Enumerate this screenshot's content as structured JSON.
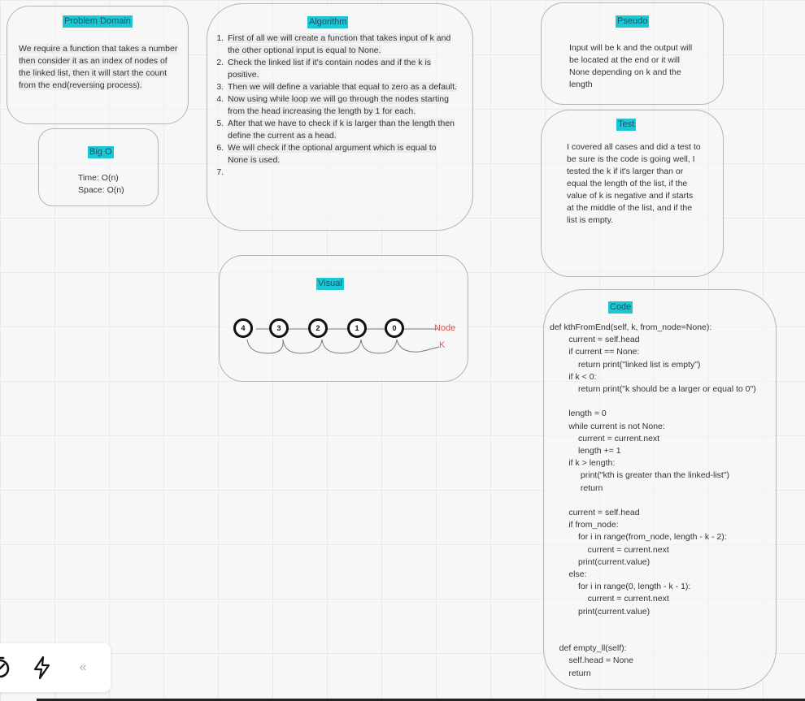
{
  "problem_domain": {
    "title": "Problem Domain",
    "text": "We require a function that takes a number then consider it as an index of nodes of the linked list, then it will start the count from the end(reversing process)."
  },
  "big_o": {
    "title": "Big O",
    "time": "Time: O(n)",
    "space": "Space: O(n)"
  },
  "algorithm": {
    "title": "Algorithm",
    "steps": [
      "First of all we will create a function that takes input of k and the other optional input is equal to None.",
      "Check the linked list if it's contain nodes and if the k is positive.",
      "Then we will define a variable that equal to zero as a default.",
      "Now using while loop we will go through the nodes starting from the head increasing the length by 1 for each.",
      "After that we have to check if k is larger than the length then define the current as a head.",
      "We will check if the optional argument which is equal to None is used.",
      ""
    ]
  },
  "pseudo": {
    "title": "Pseudo",
    "text": "Input will be k and the output will be located at the end or it will None depending on k and the length"
  },
  "test": {
    "title": "Test",
    "text": "I covered all cases and did a test to be sure is the code is going well, I tested the k if it's larger than or equal the length of the list, if the value of k is negative and if starts at the middle of the list, and if the list is empty."
  },
  "visual": {
    "title": "Visual",
    "nodes": [
      "4",
      "3",
      "2",
      "1",
      "0"
    ],
    "node_label": "Node",
    "k_label": "K",
    "label_color": "#e05050"
  },
  "code": {
    "title": "Code",
    "lines": [
      "def kthFromEnd(self, k, from_node=None):",
      "        current = self.head",
      "        if current == None:",
      "            return print(\"linked list is empty\")",
      "        if k < 0:",
      "            return print(\"k should be a larger or equal to 0\")",
      "",
      "        length = 0",
      "        while current is not None:",
      "            current = current.next",
      "            length += 1",
      "        if k > length:",
      "             print(\"kth is greater than the linked-list\")",
      "             return",
      "",
      "        current = self.head",
      "        if from_node:",
      "            for i in range(from_node, length - k - 2):",
      "                current = current.next",
      "            print(current.value)",
      "        else:",
      "            for i in range(0, length - k - 1):",
      "                current = current.next",
      "            print(current.value)",
      "",
      "",
      "    def empty_ll(self):",
      "        self.head = None",
      "        return"
    ]
  },
  "toolbar": {
    "timer_icon": "timer-icon",
    "lightning_icon": "lightning-icon",
    "collapse_label": "«"
  },
  "colors": {
    "title_bg": "#1bc7d3",
    "canvas_bg": "#f7f7f7"
  }
}
